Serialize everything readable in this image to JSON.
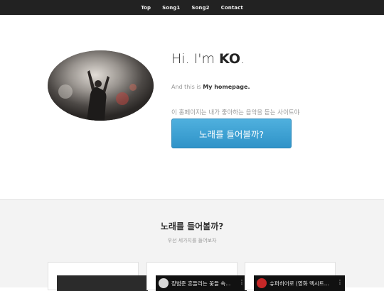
{
  "nav": {
    "items": [
      {
        "label": "Top"
      },
      {
        "label": "Song1"
      },
      {
        "label": "Song2"
      },
      {
        "label": "Contact"
      }
    ]
  },
  "hero": {
    "title_prefix": "Hi. I'm ",
    "title_name": "KO",
    "title_suffix": ".",
    "sub_prefix": "And this is ",
    "sub_strong": "My homepage.",
    "description": "이 홈페이지는 내가 좋아하는 음악을 듣는 사이트야",
    "button_label": "노래를 들어볼까?"
  },
  "songs_section": {
    "title": "노래를 들어볼까?",
    "subtitle": "우선 세가지를 들어보자",
    "videos": [
      {
        "title": ""
      },
      {
        "title": "장범준 흔들리는 꽃들 속..."
      },
      {
        "title": "슈퍼히어로 (영화 멕시트..."
      }
    ]
  },
  "colors": {
    "nav_bg": "#222222",
    "button_bg": "#3ca2d4",
    "section_bg": "#f3f3f3"
  }
}
